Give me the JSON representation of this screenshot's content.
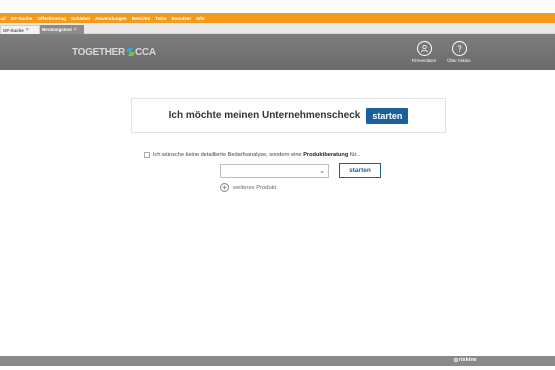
{
  "top_menu": {
    "items": [
      "ual",
      "GF-Suche",
      "Offert/Antrag",
      "Schäden",
      "Anwendungen",
      "Berichte",
      "ToDo",
      "Benutzer",
      "Info"
    ]
  },
  "tabs": [
    {
      "label": "GF-Suche",
      "close": "×"
    },
    {
      "label": "Beratungstool",
      "close": "×"
    }
  ],
  "header": {
    "logo_left": "TOGETHER",
    "logo_right": "CCA",
    "buttons": [
      {
        "label": "Firmendaten",
        "icon": "user-icon"
      },
      {
        "label": "Über riskine",
        "icon": "info-icon"
      }
    ]
  },
  "check": {
    "text": "Ich möchte meinen Unternehmenscheck",
    "button_label": "starten"
  },
  "option": {
    "text_before": "Ich wünsche keine detaillierte Bedarfsanalyse, sondern eine",
    "text_bold": "Produktberatung",
    "text_after": "für..."
  },
  "product_select": {
    "value": "",
    "chevron": "⌄"
  },
  "start_button_label": "starten",
  "add_product": {
    "icon": "+",
    "label": "weiteres Produkt"
  },
  "footer": {
    "brand": "riskine"
  },
  "colors": {
    "menu_bar": "#f49a1c",
    "primary": "#1c5f9e",
    "header": "#747474"
  }
}
